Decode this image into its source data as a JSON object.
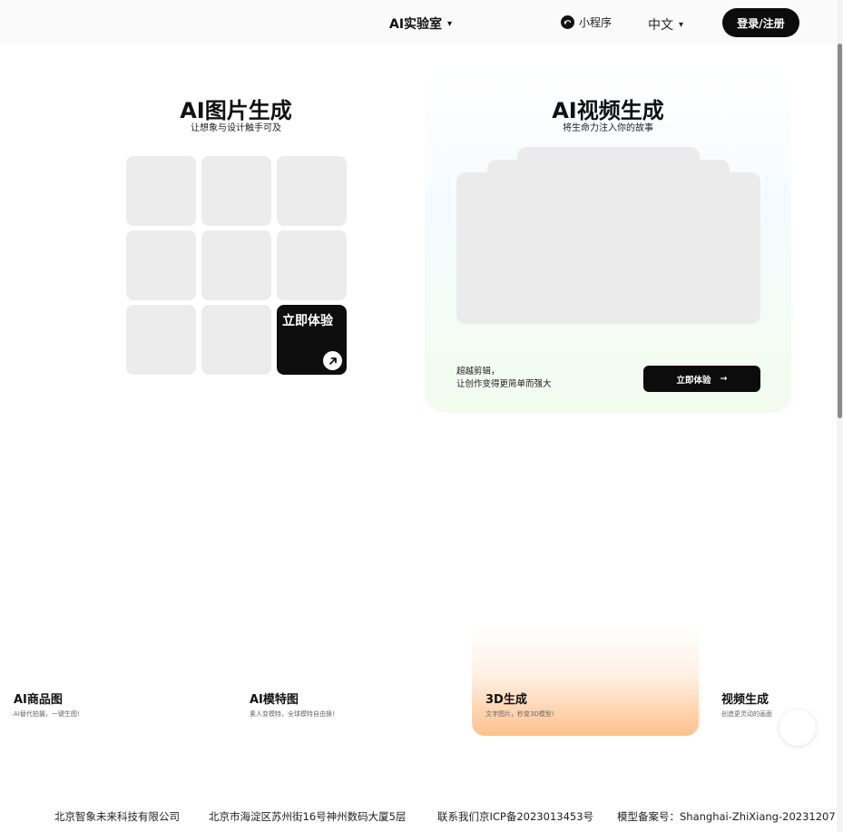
{
  "header": {
    "lab_label": "AI实验室",
    "mini_program_label": "小程序",
    "language_label": "中文",
    "login_label": "登录/注册"
  },
  "image_section": {
    "title": "AI图片生成",
    "subtitle": "让想象与设计触手可及",
    "cta_label": "立即体验"
  },
  "video_section": {
    "title": "AI视频生成",
    "subtitle": "将生命力注入你的故事",
    "desc_line1": "超越剪辑，",
    "desc_line2": "让创作变得更简单而强大",
    "button_label": "立即体验"
  },
  "features": [
    {
      "title": "AI商品图",
      "desc": "AI替代拍摄，一键生图!"
    },
    {
      "title": "AI模特图",
      "desc": "素人变模特，全球模特自由换!"
    },
    {
      "title": "3D生成",
      "desc": "文字图片，秒变3D模型!"
    },
    {
      "title": "视频生成",
      "desc": "创造更灵动的画面"
    }
  ],
  "footer": {
    "company": "北京智象未来科技有限公司",
    "address": "北京市海淀区苏州街16号神州数码大厦5层",
    "icp": "联系我们京ICP备2023013453号",
    "model_record": "模型备案号：Shanghai-ZhiXiang-20231207"
  },
  "colors": {
    "primary": "#0c0c0c",
    "tile": "#ececec",
    "accent_orange": "#ffc08c"
  },
  "icons": [
    "chevron-down-icon",
    "mini-program-icon",
    "arrow-up-right-icon",
    "arrow-right-icon"
  ]
}
